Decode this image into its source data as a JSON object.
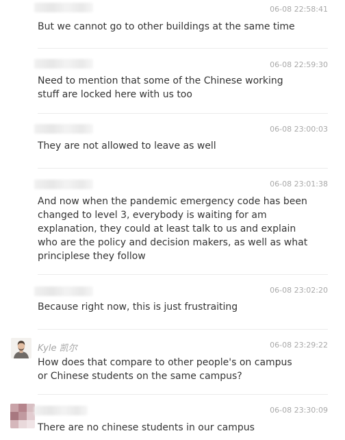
{
  "messages": [
    {
      "time": "06-08 22:58:41",
      "text": "But we cannot go to other buildings at the same time"
    },
    {
      "time": "06-08 22:59:30",
      "text": "Need to mention that some of the Chinese working stuff are locked here with us too"
    },
    {
      "time": "06-08 23:00:03",
      "text": "They are not allowed to leave as well"
    },
    {
      "time": "06-08 23:01:38",
      "text": "And now when the pandemic emergency code has been changed to level 3, everybody is waiting for am explanation, they could at least talk to us and explain who are the policy and decision makers, as well as what principlese they follow"
    },
    {
      "time": "06-08 23:02:20",
      "text": "Because right now, this is just frustraiting"
    },
    {
      "author": "Kyle 凯尔",
      "time": "06-08 23:29:22",
      "text": "How does that compare to other people's on campus or Chinese students on the same campus?"
    },
    {
      "time": "06-08 23:30:09",
      "text": "There are no chinese students in our campus"
    }
  ]
}
